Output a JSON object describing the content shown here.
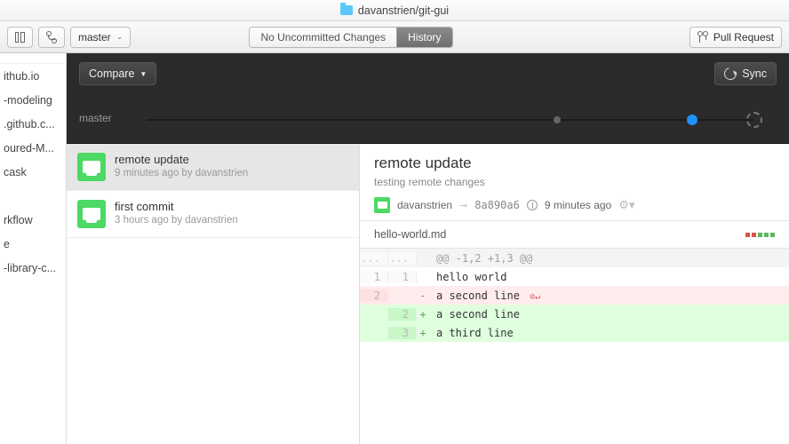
{
  "title": {
    "repo": "davanstrien/git-gui"
  },
  "toolbar": {
    "branch": "master",
    "seg_changes": "No Uncommitted Changes",
    "seg_history": "History",
    "pull_request": "Pull Request"
  },
  "leftRepos": [
    "ithub.io",
    "-modeling",
    ".github.c...",
    "oured-M...",
    "cask",
    "",
    "rkflow",
    "e",
    "-library-c..."
  ],
  "dark": {
    "compare": "Compare",
    "sync": "Sync",
    "timeline_label": "master"
  },
  "commits": [
    {
      "title": "remote update",
      "subtitle": "9 minutes ago by davanstrien",
      "selected": true
    },
    {
      "title": "first commit",
      "subtitle": "3 hours ago by davanstrien",
      "selected": false
    }
  ],
  "detail": {
    "title": "remote update",
    "description": "testing remote changes",
    "author": "davanstrien",
    "sha": "8a890a6",
    "time": "9 minutes ago",
    "file": "hello-world.md",
    "hunk": "@@ -1,2 +1,3 @@",
    "diff": [
      {
        "old": "1",
        "new": "1",
        "sign": " ",
        "text": "hello world",
        "kind": "ctx"
      },
      {
        "old": "2",
        "new": "",
        "sign": "-",
        "text": "a second line",
        "kind": "del",
        "nonl": true
      },
      {
        "old": "",
        "new": "2",
        "sign": "+",
        "text": "a second line",
        "kind": "add"
      },
      {
        "old": "",
        "new": "3",
        "sign": "+",
        "text": "a third line",
        "kind": "add"
      }
    ],
    "dot_colors": [
      "#d9534f",
      "#d9534f",
      "#5cb85c",
      "#5cb85c",
      "#5cb85c"
    ]
  }
}
